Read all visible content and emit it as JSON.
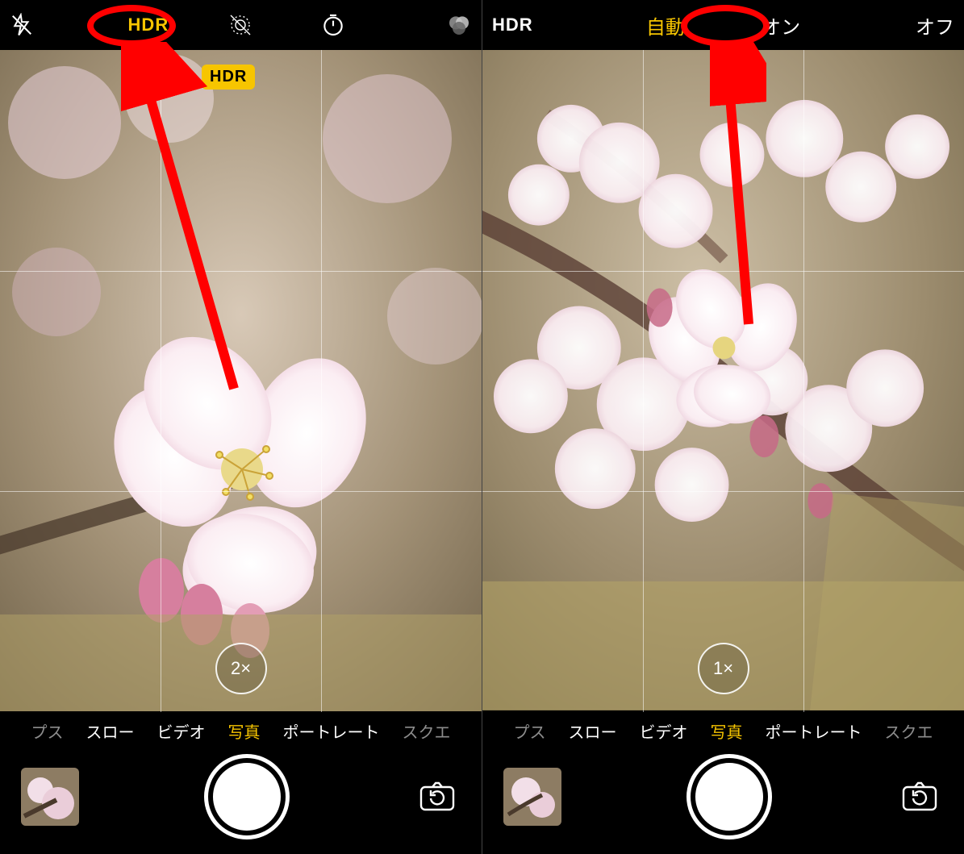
{
  "left": {
    "topbar": {
      "hdr": "HDR"
    },
    "hdr_badge": "HDR",
    "zoom": "2×",
    "modes": {
      "edge_left": "プス",
      "slow": "スロー",
      "video": "ビデオ",
      "photo": "写真",
      "portrait": "ポートレート",
      "edge_right": "スクエ"
    }
  },
  "right": {
    "topbar": {
      "hdr": "HDR",
      "auto": "自動",
      "on": "オン",
      "off": "オフ"
    },
    "zoom": "1×",
    "modes": {
      "edge_left": "プス",
      "slow": "スロー",
      "video": "ビデオ",
      "photo": "写真",
      "portrait": "ポートレート",
      "edge_right": "スクエ"
    }
  }
}
